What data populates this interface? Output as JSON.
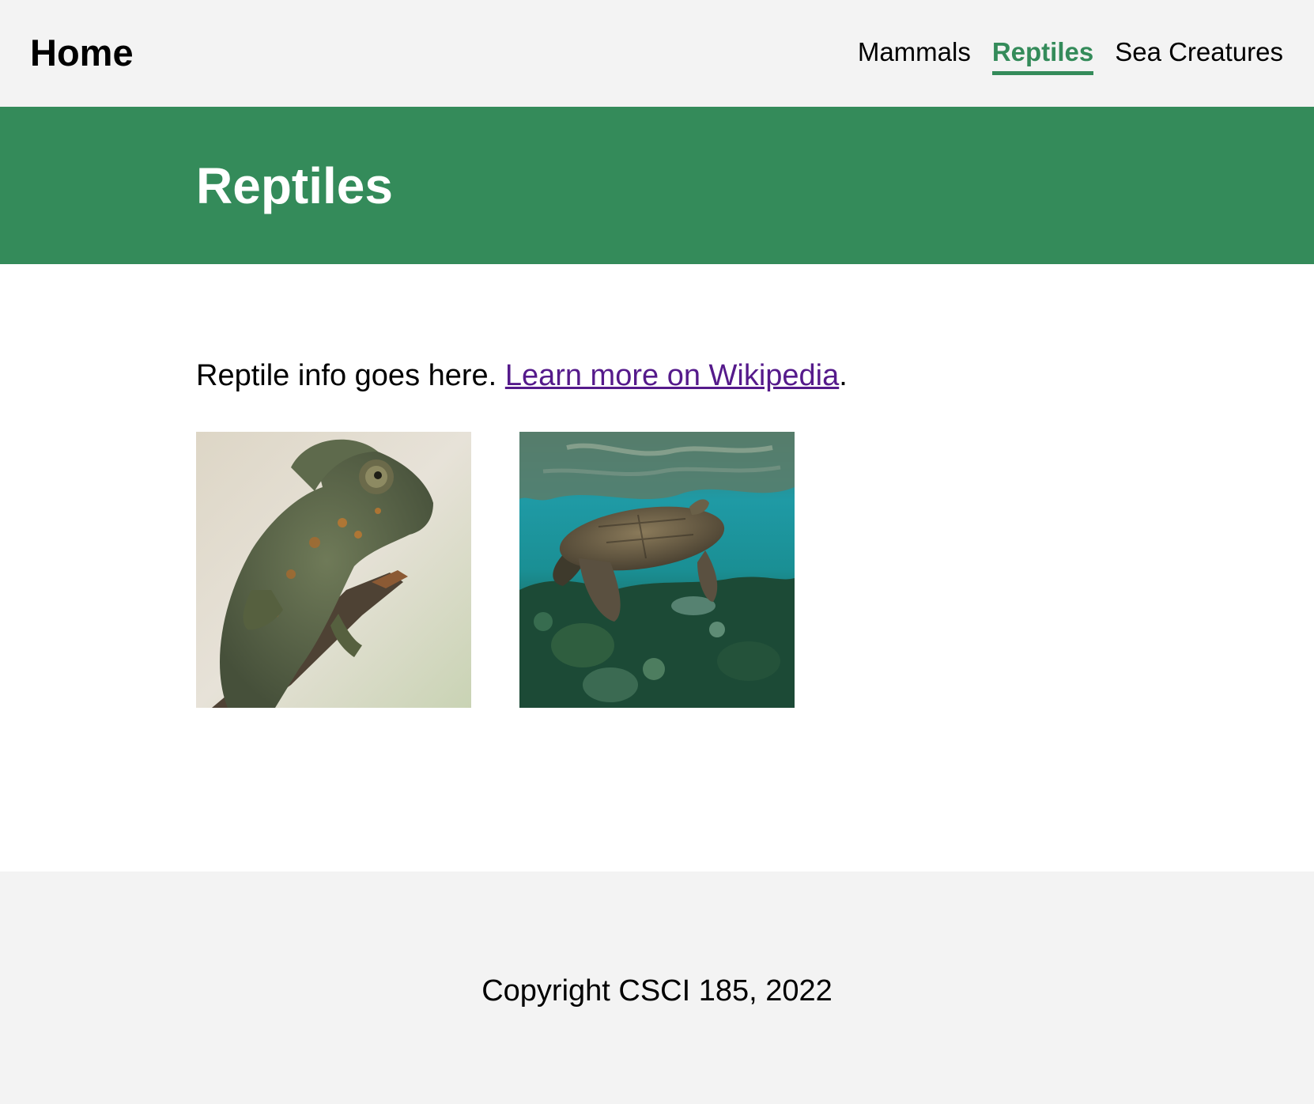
{
  "nav": {
    "brand": "Home",
    "links": [
      {
        "label": "Mammals",
        "active": false
      },
      {
        "label": "Reptiles",
        "active": true
      },
      {
        "label": "Sea Creatures",
        "active": false
      }
    ]
  },
  "hero": {
    "title": "Reptiles"
  },
  "main": {
    "intro_text": "Reptile info goes here. ",
    "link_text": "Learn more on Wikipedia",
    "after_link": ".",
    "images": [
      {
        "subject": "chameleon"
      },
      {
        "subject": "sea turtle"
      }
    ]
  },
  "footer": {
    "text": "Copyright CSCI 185, 2022"
  },
  "colors": {
    "accent": "#348b5a",
    "nav_bg": "#f3f3f3",
    "link_visited": "#551a8b"
  }
}
